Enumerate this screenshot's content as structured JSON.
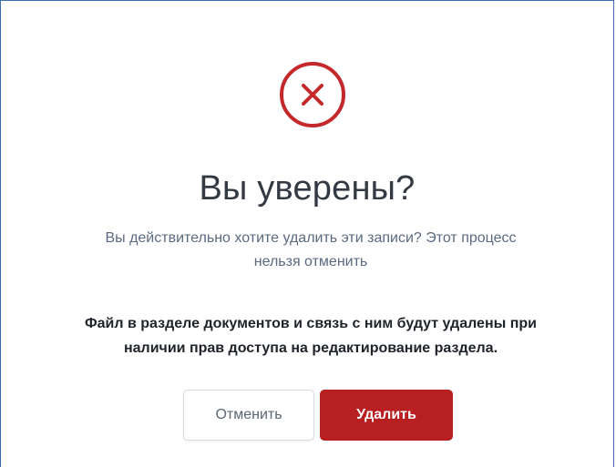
{
  "dialog": {
    "icon": "error-x-circle-icon",
    "title": "Вы уверены?",
    "subtitle_line1": "Вы действительно хотите удалить эти записи? Этот процесс",
    "subtitle_line2": "нельзя отменить",
    "warning_line1": "Файл в разделе документов и связь с ним будут удалены при",
    "warning_line2": "наличии прав доступа на редактирование раздела.",
    "cancel_label": "Отменить",
    "delete_label": "Удалить"
  },
  "colors": {
    "accent_red": "#b71f21",
    "icon_red": "#c4282a",
    "border_blue": "#3f6db1"
  }
}
